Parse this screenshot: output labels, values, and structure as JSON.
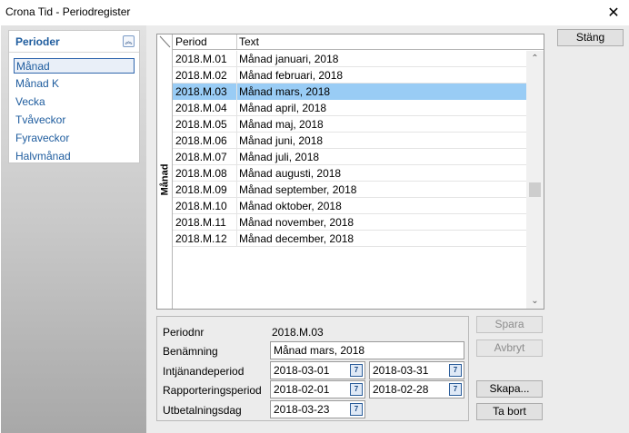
{
  "window": {
    "title": "Crona Tid - Periodregister",
    "close_glyph": "✕"
  },
  "sidebar": {
    "header": "Perioder",
    "collapse_glyph": "︽",
    "items": [
      {
        "label": "Månad",
        "selected": true
      },
      {
        "label": "Månad K",
        "selected": false
      },
      {
        "label": "Vecka",
        "selected": false
      },
      {
        "label": "Tvåveckor",
        "selected": false
      },
      {
        "label": "Fyraveckor",
        "selected": false
      },
      {
        "label": "Halvmånad",
        "selected": false
      }
    ]
  },
  "grid": {
    "side_label": "Månad",
    "columns": [
      "Period",
      "Text"
    ],
    "selected_index": 2,
    "rows": [
      {
        "period": "2018.M.01",
        "text": "Månad januari, 2018"
      },
      {
        "period": "2018.M.02",
        "text": "Månad februari, 2018"
      },
      {
        "period": "2018.M.03",
        "text": "Månad mars, 2018"
      },
      {
        "period": "2018.M.04",
        "text": "Månad april, 2018"
      },
      {
        "period": "2018.M.05",
        "text": "Månad maj, 2018"
      },
      {
        "period": "2018.M.06",
        "text": "Månad juni, 2018"
      },
      {
        "period": "2018.M.07",
        "text": "Månad juli, 2018"
      },
      {
        "period": "2018.M.08",
        "text": "Månad augusti, 2018"
      },
      {
        "period": "2018.M.09",
        "text": "Månad september, 2018"
      },
      {
        "period": "2018.M.10",
        "text": "Månad oktober, 2018"
      },
      {
        "period": "2018.M.11",
        "text": "Månad november, 2018"
      },
      {
        "period": "2018.M.12",
        "text": "Månad december, 2018"
      }
    ],
    "scroll_up_glyph": "⌃",
    "scroll_down_glyph": "⌄"
  },
  "form": {
    "periodnr_label": "Periodnr",
    "periodnr_value": "2018.M.03",
    "benamning_label": "Benämning",
    "benamning_value": "Månad mars, 2018",
    "intjanande_label": "Intjänandeperiod",
    "intjanande_from": "2018-03-01",
    "intjanande_to": "2018-03-31",
    "rapportering_label": "Rapporteringsperiod",
    "rapportering_from": "2018-02-01",
    "rapportering_to": "2018-02-28",
    "utbetalning_label": "Utbetalningsdag",
    "utbetalning_value": "2018-03-23",
    "calendar_glyph": "7"
  },
  "buttons": {
    "stang": "Stäng",
    "spara": "Spara",
    "avbryt": "Avbryt",
    "skapa": "Skapa...",
    "ta_bort": "Ta bort"
  },
  "colors": {
    "accent": "#1e5c9e",
    "selection": "#99ccf5"
  }
}
